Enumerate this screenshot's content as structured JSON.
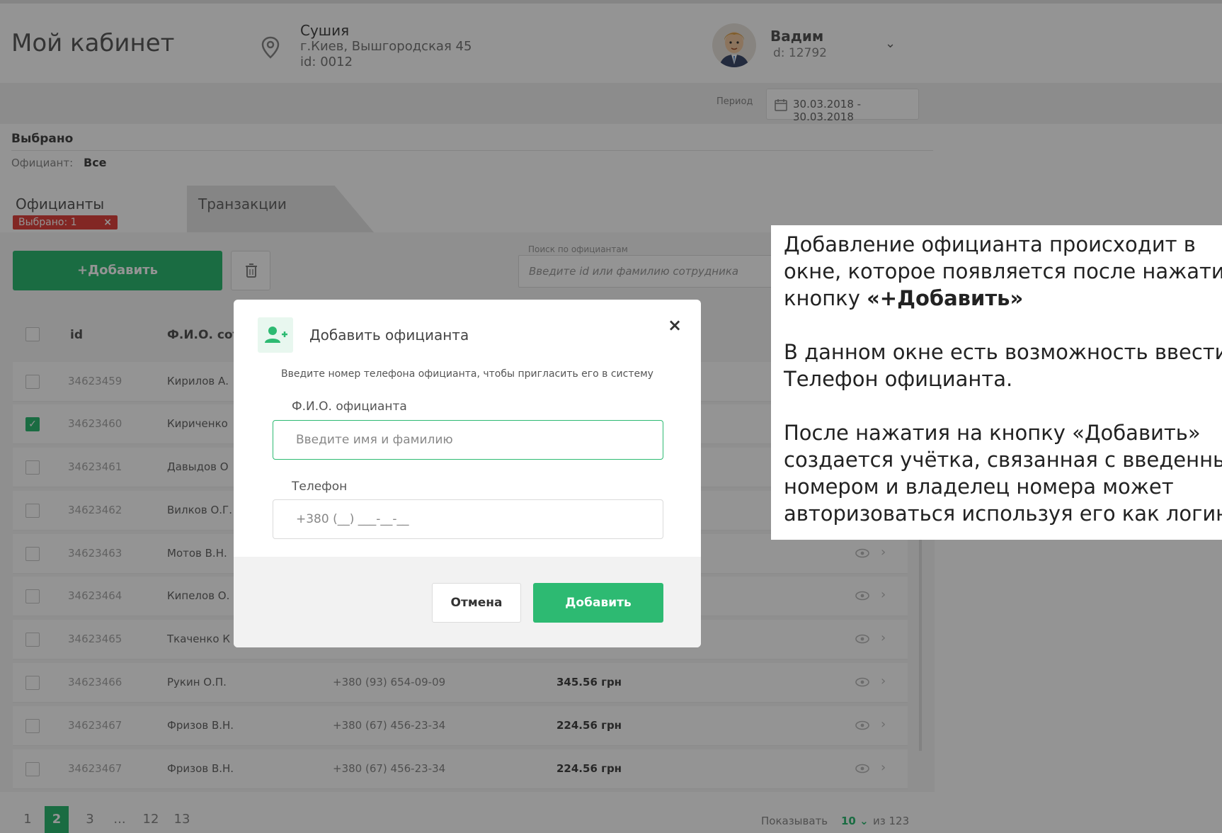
{
  "header": {
    "title": "Мой кабинет",
    "restaurant_name": "Сушия",
    "restaurant_address": "г.Киев, Вышгородская 45",
    "restaurant_id": "id: 0012",
    "user_name": "Вадим",
    "user_id": "d: 12792"
  },
  "period": {
    "label": "Период",
    "value": "30.03.2018 - 30.03.2018"
  },
  "selection": {
    "title": "Выбрано",
    "filter_label": "Официант:",
    "filter_value": "Все"
  },
  "tabs": [
    {
      "label": "Официанты",
      "badge": "Выбрано: 1",
      "active": true
    },
    {
      "label": "Транзакции",
      "active": false
    }
  ],
  "toolbar": {
    "add_label": "+Добавить",
    "search_label": "Поиск по официантам",
    "search_placeholder": "Введите id или фамилию сотрудника"
  },
  "table": {
    "headers": {
      "id": "id",
      "name": "Ф.И.О. сотр"
    },
    "rows": [
      {
        "id": "34623459",
        "name": "Кирилов А.",
        "phone": "",
        "amount": "",
        "checked": false
      },
      {
        "id": "34623460",
        "name": "Кириченко",
        "phone": "",
        "amount": "",
        "checked": true
      },
      {
        "id": "34623461",
        "name": "Давыдов О",
        "phone": "",
        "amount": "",
        "checked": false
      },
      {
        "id": "34623462",
        "name": "Вилков О.Г.",
        "phone": "",
        "amount": "",
        "checked": false
      },
      {
        "id": "34623463",
        "name": "Мотов В.Н.",
        "phone": "",
        "amount": "",
        "checked": false
      },
      {
        "id": "34623464",
        "name": "Кипелов О.",
        "phone": "",
        "amount": "",
        "checked": false
      },
      {
        "id": "34623465",
        "name": "Ткаченко К",
        "phone": "",
        "amount": "",
        "checked": false
      },
      {
        "id": "34623466",
        "name": "Рукин О.П.",
        "phone": "+380 (93) 654-09-09",
        "amount": "345.56 грн",
        "checked": false
      },
      {
        "id": "34623467",
        "name": "Фризов В.Н.",
        "phone": "+380 (67) 456-23-34",
        "amount": "224.56 грн",
        "checked": false
      },
      {
        "id": "34623467",
        "name": "Фризов В.Н.",
        "phone": "+380 (67) 456-23-34",
        "amount": "224.56 грн",
        "checked": false
      }
    ]
  },
  "pagination": {
    "pages": [
      "1",
      "2",
      "3",
      "...",
      "12",
      "13"
    ],
    "active_page": "2",
    "show_label": "Показывать",
    "page_size": "10",
    "total": "из 123"
  },
  "modal": {
    "title": "Добавить официанта",
    "description": "Введите номер телефона официанта, чтобы пригласить его в систему",
    "name_label": "Ф.И.О. официанта",
    "name_placeholder": "Введите имя и фамилию",
    "phone_label": "Телефон",
    "phone_placeholder": "+380 (__) ___-__-__",
    "cancel_label": "Отмена",
    "add_label": "Добавить"
  },
  "note": {
    "p1_line1": "Добавление официанта происходит в",
    "p1_line2": "окне, которое появляется после нажатия",
    "p1_line3_prefix": "кнопку ",
    "p1_line3_bold": "«+Добавить»",
    "p2_line1": "В данном окне есть возможность ввести",
    "p2_line2": "Телефон официанта.",
    "p3_line1": "После нажатия на кнопку «Добавить»",
    "p3_line2": "создается учётка, связанная с введенным",
    "p3_line3": "номером и владелец номера может",
    "p3_line4": "авторизоваться используя его как логин"
  },
  "colors": {
    "accent": "#2dba72",
    "badge": "#e0443e",
    "overlay": "rgba(0,0,0,0.42)"
  }
}
